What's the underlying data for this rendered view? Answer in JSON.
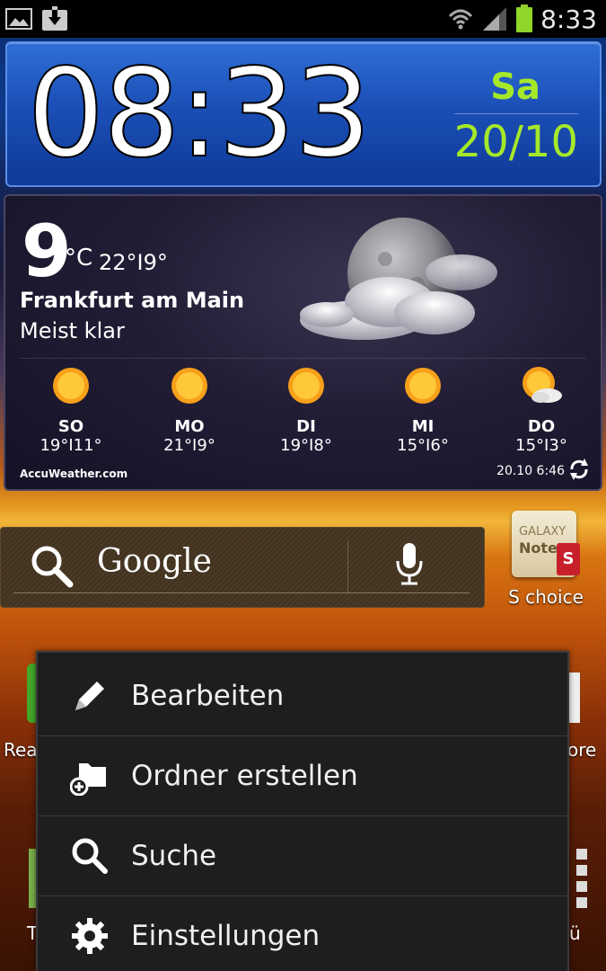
{
  "status_bar": {
    "time": "8:33",
    "icons": [
      "gallery-icon",
      "download-icon",
      "wifi-icon",
      "signal-icon",
      "battery-icon"
    ]
  },
  "clock": {
    "time": "08:33",
    "day": "Sa",
    "date": "20/10",
    "accent_color": "#a5e82a"
  },
  "weather": {
    "temp": "9",
    "unit": "°C",
    "hi_lo": "22°I9°",
    "city": "Frankfurt am Main",
    "condition": "Meist klar",
    "forecast": [
      {
        "day": "SO",
        "temps": "19°I11°",
        "icon": "sun-icon"
      },
      {
        "day": "MO",
        "temps": "21°I9°",
        "icon": "sun-icon"
      },
      {
        "day": "DI",
        "temps": "19°I8°",
        "icon": "sun-icon"
      },
      {
        "day": "MI",
        "temps": "15°I6°",
        "icon": "sun-icon"
      },
      {
        "day": "DO",
        "temps": "15°I3°",
        "icon": "sun-cloud-icon"
      }
    ],
    "brand": "AccuWeather.com",
    "updated": "20.10 6:46"
  },
  "google": {
    "logo": "Google"
  },
  "apps": {
    "s_choice_label": "S choice",
    "s_choice_galaxy": "GALAXY",
    "s_choice_note": "Note",
    "s_choice_tag": "S",
    "partial_left_top": "Rea",
    "partial_right_top": "ore",
    "partial_left_bottom": "T",
    "partial_right_bottom": "ü"
  },
  "menu": {
    "items": [
      {
        "label": "Bearbeiten",
        "icon": "pencil-icon"
      },
      {
        "label": "Ordner erstellen",
        "icon": "add-folder-icon"
      },
      {
        "label": "Suche",
        "icon": "search-icon"
      },
      {
        "label": "Einstellungen",
        "icon": "gear-icon"
      }
    ]
  }
}
